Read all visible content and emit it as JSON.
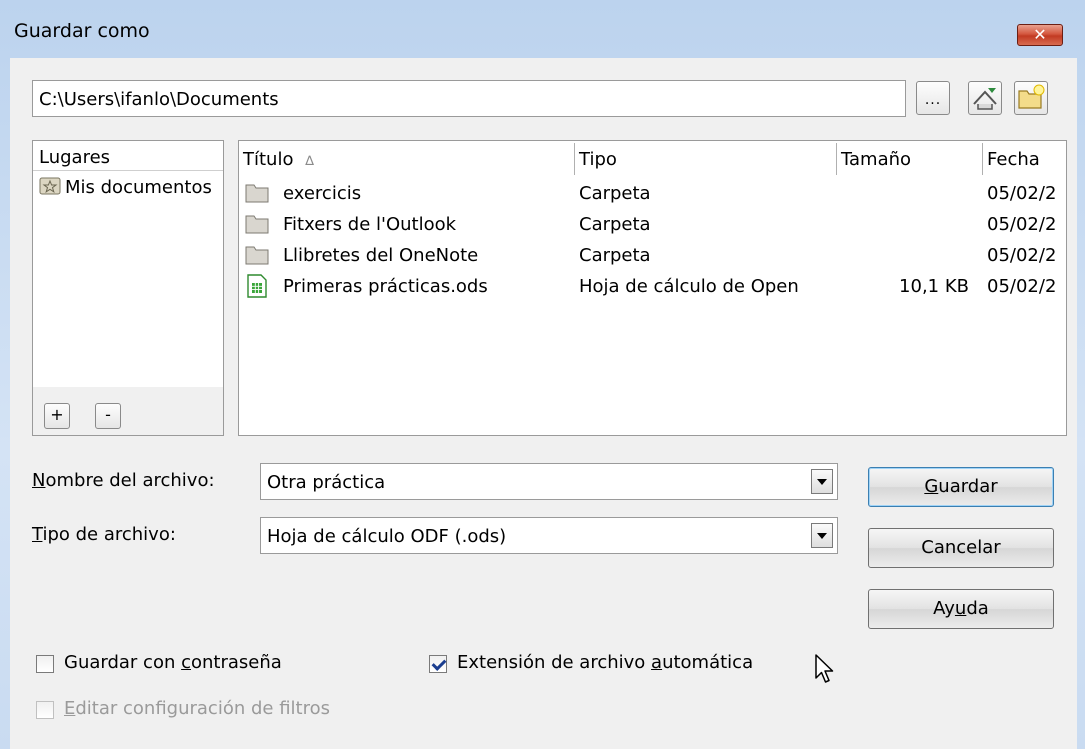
{
  "window": {
    "title": "Guardar como",
    "close_symbol": "✕"
  },
  "path": {
    "value": "C:\\Users\\ifanlo\\Documents"
  },
  "toolbar": {
    "browse_label": "..."
  },
  "places": {
    "header": "Lugares",
    "items": [
      {
        "label": "Mis documentos",
        "icon": "documents-star-icon"
      }
    ],
    "add_label": "+",
    "remove_label": "-"
  },
  "files": {
    "columns": {
      "title": "Título",
      "type": "Tipo",
      "size": "Tamaño",
      "date": "Fecha"
    },
    "sort_indicator": "∆",
    "rows": [
      {
        "name": "exercicis",
        "type": "Carpeta",
        "size": "",
        "date": "05/02/2",
        "icon": "folder-icon"
      },
      {
        "name": "Fitxers de l'Outlook",
        "type": "Carpeta",
        "size": "",
        "date": "05/02/2",
        "icon": "folder-icon"
      },
      {
        "name": "Llibretes del OneNote",
        "type": "Carpeta",
        "size": "",
        "date": "05/02/2",
        "icon": "folder-icon"
      },
      {
        "name": "Primeras prácticas.ods",
        "type": "Hoja de cálculo de Open",
        "size": "10,1 KB",
        "date": "05/02/2",
        "icon": "spreadsheet-file-icon"
      }
    ]
  },
  "form": {
    "filename_label_underlined": "N",
    "filename_label_rest": "ombre del archivo:",
    "filename_value": "Otra práctica",
    "filetype_label_underlined": "T",
    "filetype_label_rest": "ipo de archivo:",
    "filetype_value": "Hoja de cálculo ODF (.ods)"
  },
  "buttons": {
    "save_underlined": "G",
    "save_rest": "uardar",
    "cancel": "Cancelar",
    "help_pre": "Ay",
    "help_underlined": "u",
    "help_post": "da"
  },
  "options": {
    "password": {
      "pre": "Guardar con ",
      "underlined": "c",
      "post": "ontraseña",
      "checked": false
    },
    "auto_ext": {
      "pre": "Extensión de archivo ",
      "underlined": "a",
      "post": "utomática",
      "checked": true
    },
    "filters": {
      "pre": "",
      "underlined": "E",
      "post": "ditar configuración de filtros",
      "checked": false,
      "disabled": true
    }
  }
}
